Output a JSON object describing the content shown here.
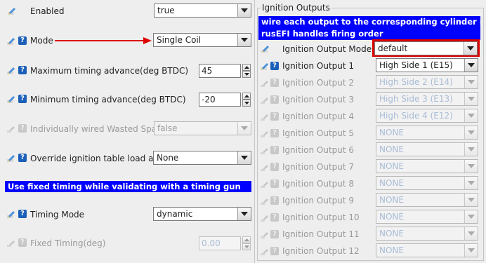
{
  "left": {
    "enabled_label": "Enabled",
    "enabled_value": "true",
    "mode_label": "Mode",
    "mode_value": "Single Coil",
    "max_adv_label": "Maximum timing advance(deg BTDC)",
    "max_adv_value": "45",
    "min_adv_label": "Minimum timing advance(deg BTDC)",
    "min_adv_value": "-20",
    "wasted_label": "Individually wired Wasted Spark",
    "wasted_value": "false",
    "override_label": "Override ignition table load axis",
    "override_value": "None",
    "banner": "Use fixed timing while validating with a timing gun",
    "timing_mode_label": "Timing Mode",
    "timing_mode_value": "dynamic",
    "fixed_timing_label": "Fixed Timing(deg)",
    "fixed_timing_value": "0.00"
  },
  "right": {
    "title": "Ignition Outputs",
    "banner1": "wire each output to the corresponding cylinder number",
    "banner2": "rusEFI handles firing order",
    "mode_label": "Ignition Output Mode",
    "mode_value": "default",
    "outputs": [
      {
        "label": "Ignition Output 1",
        "value": "High Side 1 (E15)"
      },
      {
        "label": "Ignition Output 2",
        "value": "High Side 2 (E14)"
      },
      {
        "label": "Ignition Output 3",
        "value": "High Side 3 (E13)"
      },
      {
        "label": "Ignition Output 4",
        "value": "High Side 4 (E12)"
      },
      {
        "label": "Ignition Output 5",
        "value": "NONE"
      },
      {
        "label": "Ignition Output 6",
        "value": "NONE"
      },
      {
        "label": "Ignition Output 7",
        "value": "NONE"
      },
      {
        "label": "Ignition Output 8",
        "value": "NONE"
      },
      {
        "label": "Ignition Output 9",
        "value": "NONE"
      },
      {
        "label": "Ignition Output 10",
        "value": "NONE"
      },
      {
        "label": "Ignition Output 11",
        "value": "NONE"
      },
      {
        "label": "Ignition Output 12",
        "value": "NONE"
      }
    ]
  },
  "colors": {
    "banner": "#0000ff",
    "highlight": "#dd0000",
    "help_icon": "#1b5fb8",
    "arrow": "#dd0000"
  }
}
